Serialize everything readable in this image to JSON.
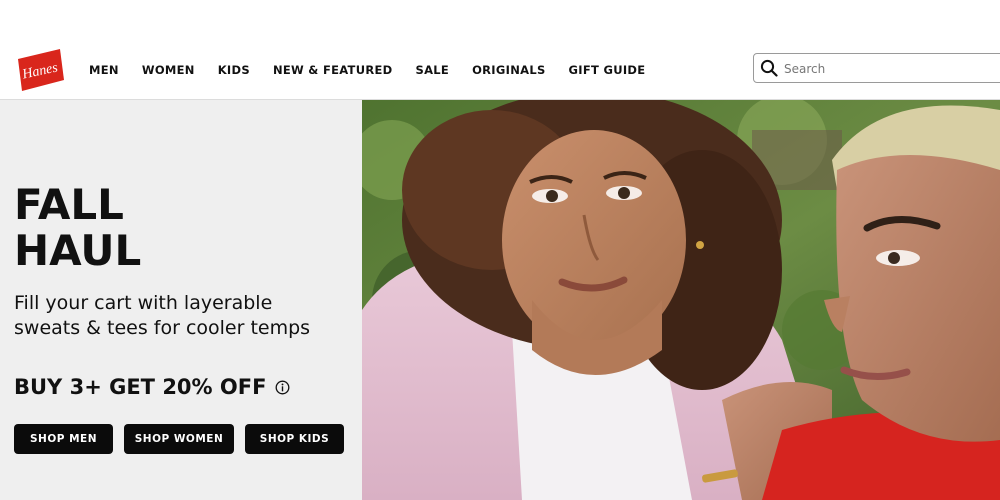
{
  "brand": {
    "logo_text": "Hanes",
    "color": "#d9261c"
  },
  "nav": {
    "items": [
      {
        "label": "MEN"
      },
      {
        "label": "WOMEN"
      },
      {
        "label": "KIDS"
      },
      {
        "label": "NEW & FEATURED"
      },
      {
        "label": "SALE"
      },
      {
        "label": "ORIGINALS"
      },
      {
        "label": "GIFT GUIDE"
      }
    ]
  },
  "search": {
    "placeholder": "Search",
    "value": "",
    "icon": "search-icon"
  },
  "hero": {
    "title_line1": "FALL",
    "title_line2": "HAUL",
    "subtitle": "Fill your cart with layerable sweats & tees for cooler temps",
    "offer": "BUY 3+ GET 20% OFF",
    "offer_icon": "info-icon",
    "buttons": [
      {
        "label": "SHOP MEN"
      },
      {
        "label": "SHOP WOMEN"
      },
      {
        "label": "SHOP KIDS"
      }
    ]
  },
  "colors": {
    "hero_panel": "#efefef",
    "button_bg": "#0b0b0b",
    "button_text": "#ffffff"
  }
}
